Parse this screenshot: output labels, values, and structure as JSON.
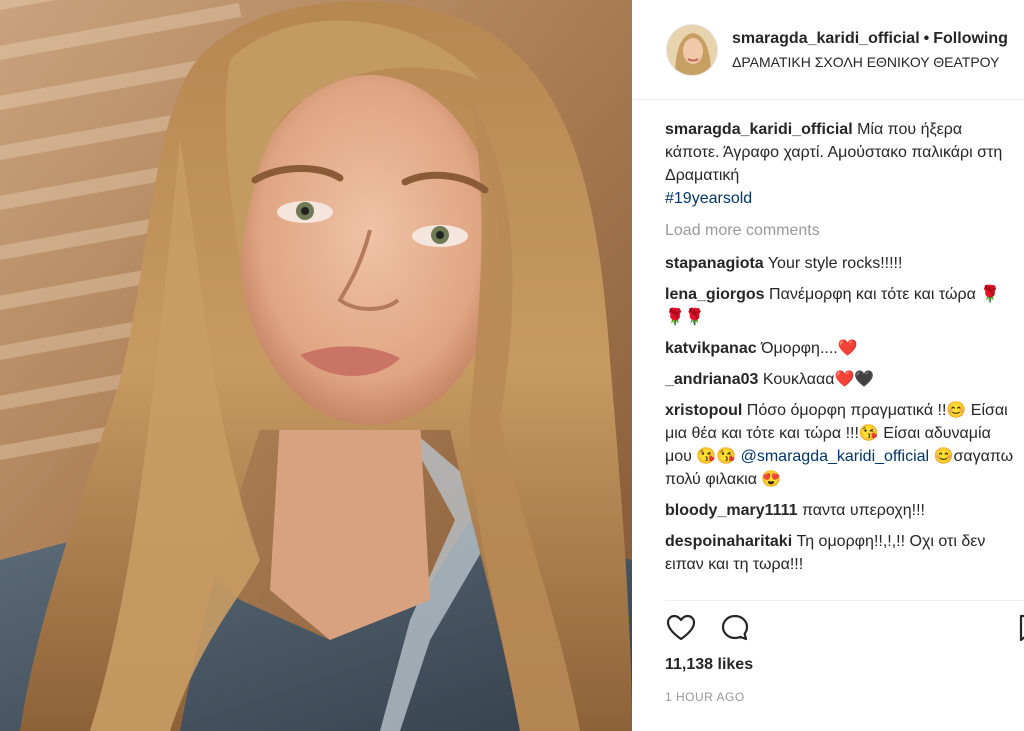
{
  "post": {
    "header": {
      "username": "smaragda_karidi_official",
      "separator": "•",
      "follow_status": "Following",
      "location": "ΔΡΑΜΑΤΙΚΗ ΣΧΟΛΗ ΕΘΝΙΚΟΥ ΘΕΑΤΡΟΥ"
    },
    "caption": {
      "username": "smaragda_karidi_official",
      "text": "Μία που ήξερα κάποτε. Άγραφο χαρτί. Αμούστακο παλικάρι στη Δραματική",
      "hashtag": "#19yearsold"
    },
    "load_more": "Load more comments",
    "comments": [
      {
        "username": "stapanagiota",
        "text": "Your style rocks!!!!!"
      },
      {
        "username": "lena_giorgos",
        "text": "Πανέμορφη και τότε και τώρα 🌹🌹🌹"
      },
      {
        "username": "katvikpanac",
        "text": "Όμορφη....❤️"
      },
      {
        "username": "_andriana03",
        "text": "Κουκλααα❤️🖤"
      },
      {
        "username": "xristopoul",
        "text": "Πόσο όμορφη πραγματικά !!😊 Είσαι μια θέα και τότε και τώρα !!!😘 Είσαι αδυναμία μου 😘😘",
        "mention": "@smaragda_karidi_official",
        "text_after": "😊σαγαπω πολύ φιλακια 😍"
      },
      {
        "username": "bloody_mary1111",
        "text": "παντα υπεροχη!!!"
      },
      {
        "username": "despoinaharitaki",
        "text": "Τη ομορφη!!,!,!! Οχι οτι δεν ειπαν και τη τωρα!!!"
      }
    ],
    "likes": "11,138 likes",
    "time": "1 HOUR AGO",
    "icons": {
      "like": "heart-icon",
      "comment": "comment-icon",
      "save": "bookmark-icon"
    }
  }
}
